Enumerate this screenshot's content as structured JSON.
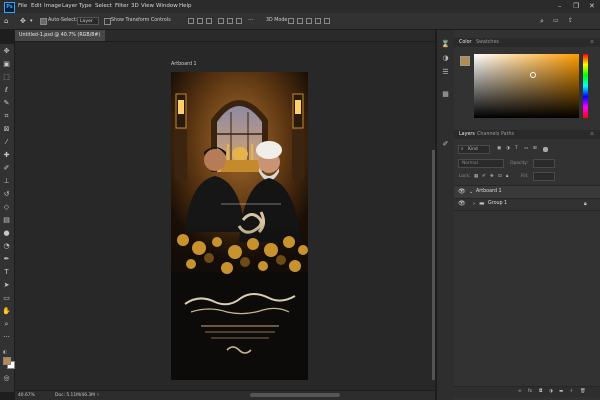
{
  "menubar": {
    "items": [
      "File",
      "Edit",
      "Image",
      "Layer",
      "Type",
      "Select",
      "Filter",
      "3D",
      "View",
      "Window",
      "Help"
    ]
  },
  "options_bar": {
    "auto_select_label": "Auto-Select:",
    "auto_select_value": "Layer",
    "transform_label": "Show Transform Controls",
    "mode_3d_label": "3D Mode:"
  },
  "document": {
    "tab_title": "Untitled-1.psd @ 40.7% (RGB/8#)",
    "artboard_label": "Artboard 1"
  },
  "status_bar": {
    "zoom": "40.67%",
    "doc_info": "Doc: 5.11M/46.3M"
  },
  "panels": {
    "color_tabs": [
      "Color",
      "Swatches"
    ],
    "layers_tabs": [
      "Layers",
      "Channels",
      "Paths"
    ],
    "filter_kind": "Kind",
    "blend_mode": "Normal",
    "opacity_label": "Opacity:",
    "lock_label": "Lock:",
    "fill_label": "Fill:",
    "layers": [
      {
        "name": "Artboard 1"
      },
      {
        "name": "Group 1"
      }
    ]
  },
  "colors": {
    "foreground": "#b58b4f",
    "background": "#ffffff"
  },
  "icons": {
    "tools": [
      "move-icon",
      "artboard-icon",
      "marquee-icon",
      "lasso-icon",
      "quick-select-icon",
      "crop-icon",
      "frame-icon",
      "eyedropper-icon",
      "healing-icon",
      "brush-icon",
      "stamp-icon",
      "history-brush-icon",
      "eraser-icon",
      "gradient-icon",
      "blur-icon",
      "dodge-icon",
      "pen-icon",
      "type-icon",
      "path-select-icon",
      "shape-icon",
      "hand-icon",
      "zoom-icon",
      "more-tools-icon"
    ]
  }
}
